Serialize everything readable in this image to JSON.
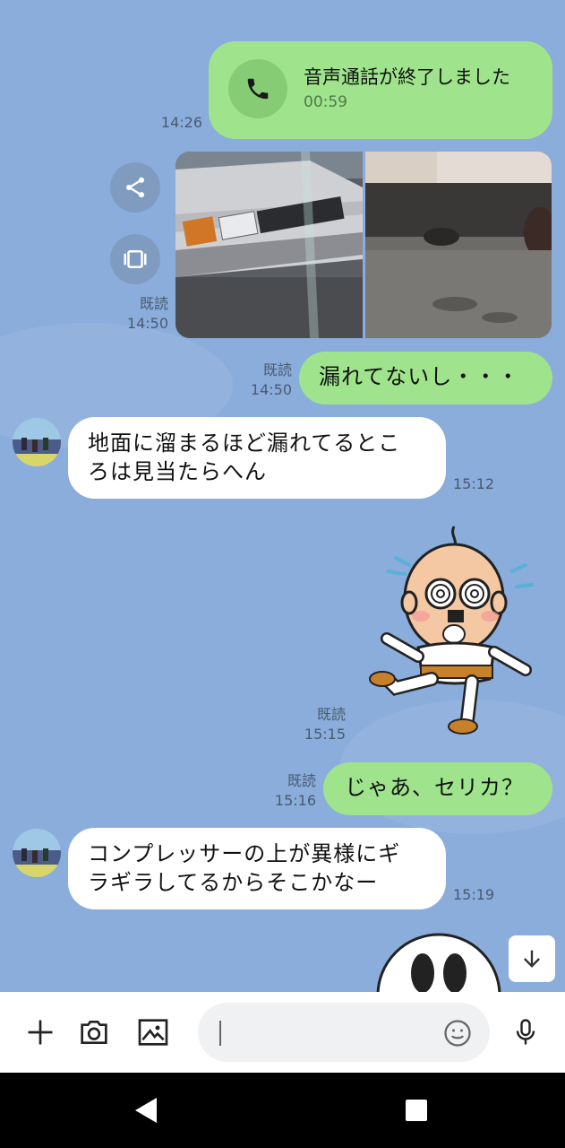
{
  "messages": {
    "call": {
      "title": "音声通話が終了しました",
      "duration": "00:59",
      "time": "14:26"
    },
    "photos": {
      "read": "既読",
      "time": "14:50"
    },
    "out1": {
      "text": "漏れてないし・・・",
      "read": "既読",
      "time": "14:50"
    },
    "in1": {
      "line1": "地面に溜まるほど漏れてるとこ",
      "line2": "ろは見当たらへん",
      "time": "15:12"
    },
    "sticker": {
      "read": "既読",
      "time": "15:15"
    },
    "out2": {
      "text": "じゃあ、セリカ？",
      "read": "既読",
      "time": "15:16"
    },
    "in2": {
      "line1": "コンプレッサーの上が異様にギ",
      "line2": "ラギラしてるからそこかなー",
      "time": "15:19"
    }
  },
  "input": {
    "placeholder": ""
  },
  "icons": {
    "call": "phone-icon",
    "share": "share-icon",
    "gallery": "carousel-icon",
    "add": "plus-icon",
    "camera": "camera-icon",
    "image": "image-icon",
    "emoji": "smiley-icon",
    "mic": "mic-icon",
    "scroll": "arrow-down-icon",
    "back": "back-triangle-icon",
    "recents": "recents-square-icon"
  },
  "colors": {
    "background": "#8aaddc",
    "outgoing": "#9fe48c",
    "incoming": "#ffffff"
  }
}
